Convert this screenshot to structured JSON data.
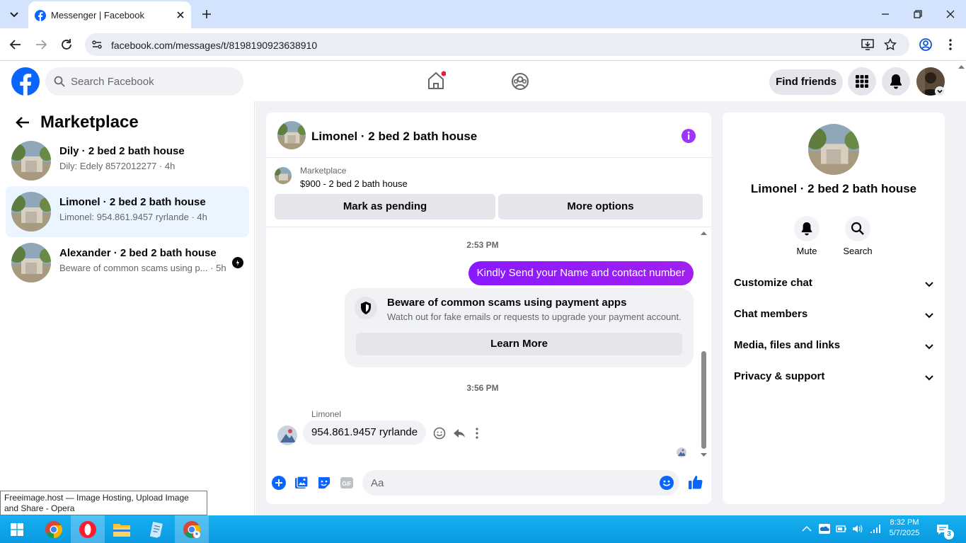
{
  "browser": {
    "tab_title": "Messenger | Facebook",
    "url": "facebook.com/messages/t/8198190923638910"
  },
  "fb_header": {
    "search_placeholder": "Search Facebook",
    "find_friends": "Find friends"
  },
  "left": {
    "title": "Marketplace",
    "conversations": [
      {
        "title": "Dily · 2 bed 2 bath house",
        "subtitle": "Dily: Edely 8572012277 · 4h"
      },
      {
        "title": "Limonel · 2 bed 2 bath house",
        "subtitle": "Limonel: 954.861.9457 ryrlande · 4h"
      },
      {
        "title": "Alexander · 2 bed 2 bath house",
        "subtitle": "Beware of common scams using p...",
        "time": "· 5h"
      }
    ]
  },
  "chat": {
    "name": "Limonel · 2 bed 2 bath house",
    "listing": {
      "label": "Marketplace",
      "price_title": "$900 - 2 bed 2 bath house",
      "mark_pending": "Mark as pending",
      "more_options": "More options"
    },
    "timestamp1": "2:53 PM",
    "outgoing_message": "Kindly Send your Name and contact number",
    "scam_notice": {
      "title": "Beware of common scams using payment apps",
      "body": "Watch out for fake emails or requests to upgrade your payment account.",
      "button": "Learn More"
    },
    "timestamp2": "3:56 PM",
    "sender_name": "Limonel",
    "incoming_message": "954.861.9457  ryrlande",
    "composer_placeholder": "Aa"
  },
  "right": {
    "name": "Limonel · 2 bed 2 bath house",
    "actions": [
      {
        "label": "Mute"
      },
      {
        "label": "Search"
      }
    ],
    "sections": [
      "Customize chat",
      "Chat members",
      "Media, files and links",
      "Privacy & support"
    ]
  },
  "tooltip": "Freeimage.host — Image Hosting, Upload Image and Share - Opera",
  "taskbar": {
    "time": "8:32 PM",
    "date": "5/7/2025",
    "notif_count": "3"
  },
  "colors": {
    "fb_blue": "#0866ff",
    "messenger_purple": "#a033ff",
    "active_conv": "#ebf5ff"
  }
}
